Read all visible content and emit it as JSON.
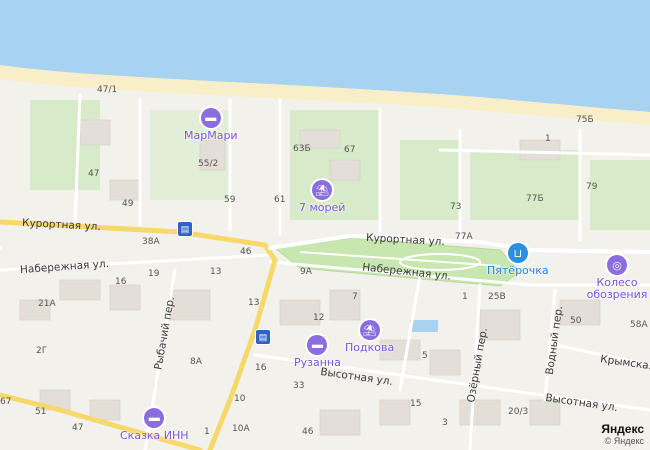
{
  "map": {
    "colors": {
      "water": "#a8d3f0",
      "beach": "#f8efc8",
      "land": "#f3f1ec",
      "park": "#c8e6b0",
      "road": "#ffffff",
      "main_road": "#f7d86a",
      "poi": "#8b6de0"
    },
    "streets": {
      "kurortnaya_w": "Курортная ул.",
      "kurortnaya_e": "Курортная ул.",
      "naberezhnaya_w": "Набережная ул.",
      "naberezhnaya_e": "Набережная ул.",
      "vysotnaya_w": "Высотная ул.",
      "vysotnaya_e": "Высотная ул.",
      "krymskaya": "Крымская",
      "rybachiy": "Рыбачий пер.",
      "ozerny": "Озёрный пер.",
      "vodny": "Водный пер."
    },
    "pois": {
      "marmari": "МарМари",
      "sem_morey": "7 морей",
      "pyaterochka": "Пятёрочка",
      "koleso": "Колесо обозрения",
      "ruzanna": "Рузанна",
      "podkova": "Подкова",
      "skazka": "Сказка ИНН"
    },
    "house_numbers": {
      "n47_1": "47/1",
      "n75b": "75Б",
      "n1a": "1",
      "n55_2": "55/2",
      "n63b": "63Б",
      "n67": "67",
      "n47": "47",
      "n49": "49",
      "n59": "59",
      "n61": "61",
      "n79": "79",
      "n73": "73",
      "n77b": "77Б",
      "n38a": "38А",
      "n77a": "77А",
      "n46": "46",
      "n19": "19",
      "n13": "13",
      "n9a": "9А",
      "n16": "16",
      "n7": "7",
      "n1b": "1",
      "n25v": "25В",
      "n21a": "21А",
      "n13b": "13",
      "n12": "12",
      "n50": "50",
      "n58a": "58А",
      "n2g": "2Г",
      "n8a": "8А",
      "n5": "5",
      "n16b": "16",
      "n33": "33",
      "n51": "51",
      "n47b": "47",
      "n10": "10",
      "n15": "15",
      "n20_3": "20/3",
      "n1c": "1",
      "n10a": "10А",
      "n46b": "46",
      "n3": "3",
      "n67b": "67"
    },
    "attribution": {
      "brand": "Яндекс",
      "copyright": "© Яндекс"
    }
  }
}
